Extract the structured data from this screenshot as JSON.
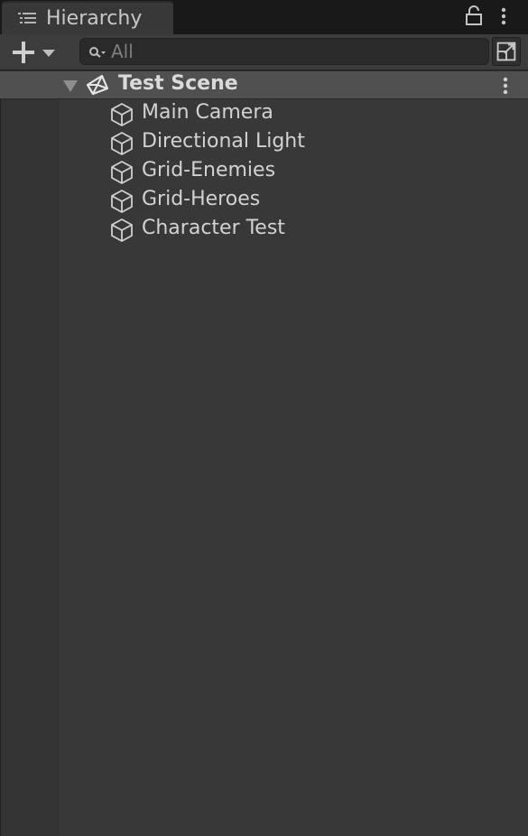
{
  "tab": {
    "title": "Hierarchy",
    "icon": "hierarchy-list-icon"
  },
  "toolbar": {
    "add_icon": "plus-icon",
    "search_placeholder": "All",
    "search_value": ""
  },
  "scene": {
    "name": "Test Scene",
    "icon": "unity-logo-icon",
    "expanded": true
  },
  "items": [
    {
      "label": "Main Camera",
      "icon": "gameobject-cube-icon"
    },
    {
      "label": "Directional Light",
      "icon": "gameobject-cube-icon"
    },
    {
      "label": "Grid-Enemies",
      "icon": "gameobject-cube-icon"
    },
    {
      "label": "Grid-Heroes",
      "icon": "gameobject-cube-icon"
    },
    {
      "label": "Character Test",
      "icon": "gameobject-cube-icon"
    }
  ],
  "colors": {
    "panel_bg": "#383838",
    "tab_bar_bg": "#191919",
    "scene_row_bg": "#505050",
    "text": "#d2d2d2"
  }
}
